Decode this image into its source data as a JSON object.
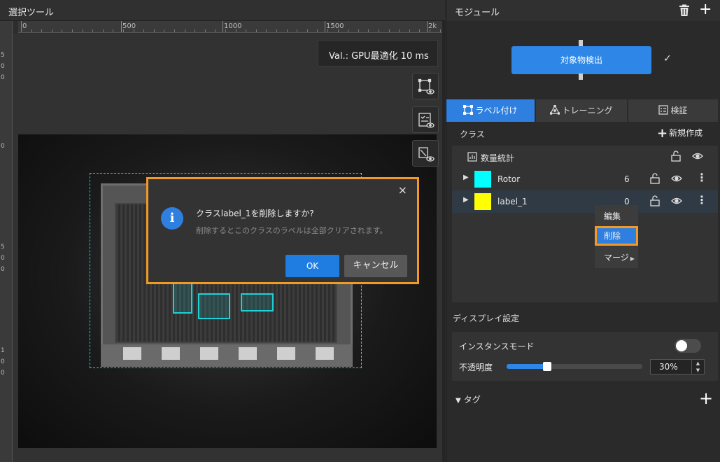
{
  "left": {
    "title": "選択ツール",
    "ruler_ticks": [
      "0",
      "500",
      "1000",
      "1500",
      "2k"
    ],
    "ruler_left_digits": [
      "5",
      "0",
      "0",
      "0",
      "5",
      "0",
      "0",
      "1",
      "0",
      "0"
    ],
    "val_display": "Val.: GPU最適化 10 ms",
    "tool_icons": [
      "roi-view-icon",
      "checklist-view-icon",
      "mask-view-icon"
    ]
  },
  "dialog": {
    "question": "クラスlabel_1を削除しますか?",
    "description": "削除するとこのクラスのラベルは全部クリアされます。",
    "ok_label": "OK",
    "cancel_label": "キャンセル",
    "close_glyph": "×",
    "info_glyph": "i",
    "accent": "#f29a27"
  },
  "right": {
    "title": "モジュール",
    "module_label": "対象物検出",
    "check_glyph": "✓",
    "tabs": [
      {
        "label": "ラベル付け",
        "active": true
      },
      {
        "label": "トレーニング",
        "active": false
      },
      {
        "label": "検証",
        "active": false
      }
    ],
    "class_header": "クラス",
    "new_class_label": "新規作成",
    "stats_label": "数量統計",
    "classes": [
      {
        "name": "Rotor",
        "count": "6",
        "color": "#00ffff"
      },
      {
        "name": "label_1",
        "count": "0",
        "color": "#ffff00"
      }
    ],
    "context_menu": {
      "edit": "編集",
      "delete": "削除",
      "merge": "マージ"
    },
    "display_settings": {
      "label": "ディスプレイ設定",
      "instance_mode_label": "インスタンスモード",
      "instance_mode_on": false,
      "opacity_label": "不透明度",
      "opacity_value": "30%",
      "opacity_fraction": 0.3
    },
    "tags_label": "タグ",
    "accent_color": "#2e7fe0"
  }
}
